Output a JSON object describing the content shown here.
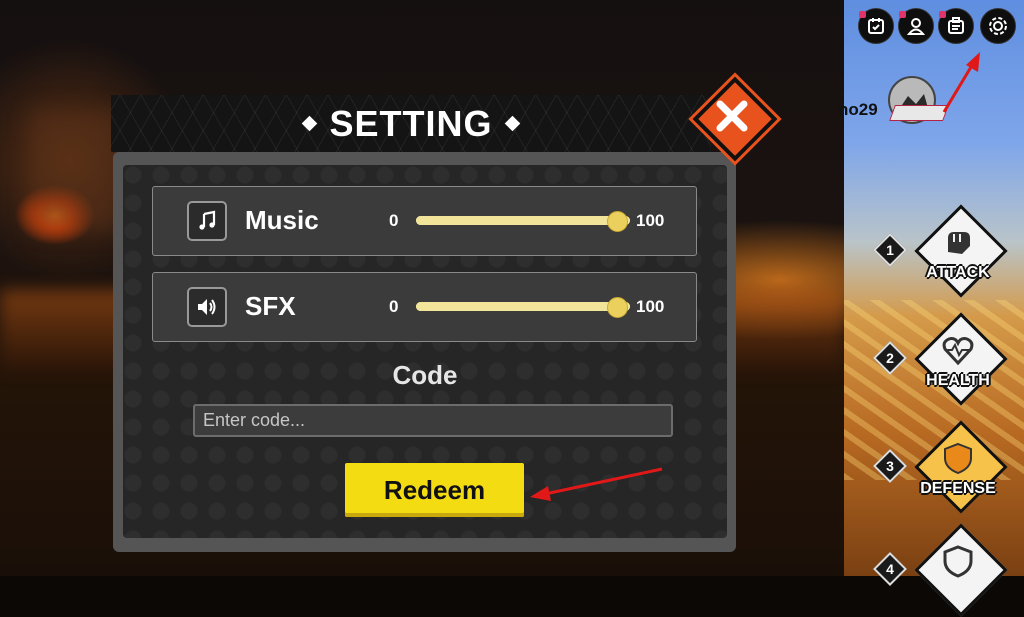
{
  "modal": {
    "title": "SETTING",
    "close_icon": "close-x-icon"
  },
  "settings": {
    "music": {
      "label": "Music",
      "icon": "music-note-icon",
      "min": "0",
      "max": "100",
      "value": 100
    },
    "sfx": {
      "label": "SFX",
      "icon": "speaker-icon",
      "min": "0",
      "max": "100",
      "value": 100
    }
  },
  "code": {
    "label": "Code",
    "placeholder": "Enter code...",
    "redeem_label": "Redeem"
  },
  "hud": {
    "top_icons": [
      "calendar-check-icon",
      "profile-icon",
      "clipboard-icon",
      "gear-icon"
    ],
    "player_name": "no29",
    "skills": [
      {
        "number": "1",
        "label": "ATTACK",
        "icon": "fist-icon"
      },
      {
        "number": "2",
        "label": "HEALTH",
        "icon": "heart-icon"
      },
      {
        "number": "3",
        "label": "DEFENSE",
        "icon": "shield-icon"
      },
      {
        "number": "4",
        "label": "",
        "icon": "shield-up-icon"
      }
    ]
  },
  "colors": {
    "close_orange": "#e8521c",
    "redeem_yellow": "#f3dc12",
    "slider_track": "#f4e8a3",
    "slider_knob": "#ecd05e",
    "annotation_red": "#e01818"
  }
}
